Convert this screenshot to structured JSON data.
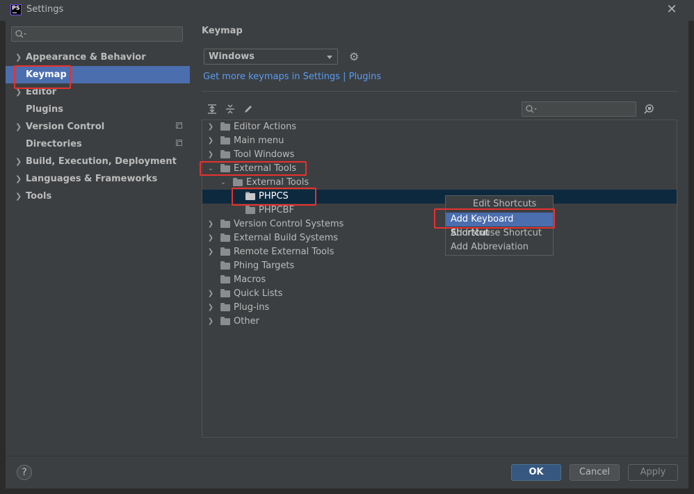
{
  "window": {
    "title": "Settings",
    "app_logo": "PS"
  },
  "sidebar": {
    "search_placeholder": "",
    "items": [
      {
        "label": "Appearance & Behavior",
        "has_chevron": true
      },
      {
        "label": "Keymap",
        "selected": true
      },
      {
        "label": "Editor",
        "has_chevron": true
      },
      {
        "label": "Plugins"
      },
      {
        "label": "Version Control",
        "has_chevron": true,
        "project_icon": true
      },
      {
        "label": "Directories",
        "project_icon": true
      },
      {
        "label": "Build, Execution, Deployment",
        "has_chevron": true
      },
      {
        "label": "Languages & Frameworks",
        "has_chevron": true
      },
      {
        "label": "Tools",
        "has_chevron": true
      }
    ]
  },
  "main": {
    "title": "Keymap",
    "keymap_select": {
      "value": "Windows"
    },
    "plugins_link": "Get more keymaps in Settings | Plugins",
    "toolbar": {
      "expand_all": "expand-all-icon",
      "collapse_all": "collapse-all-icon",
      "edit": "pencil-icon",
      "find_by_shortcut": "find-shortcut-icon"
    },
    "tree_search_placeholder": ""
  },
  "tree": [
    {
      "label": "Editor Actions",
      "expanded": false
    },
    {
      "label": "Main menu",
      "expanded": false
    },
    {
      "label": "Tool Windows",
      "expanded": false
    },
    {
      "label": "External Tools",
      "expanded": true
    },
    {
      "label": "External Tools",
      "expanded": true
    },
    {
      "label": "PHPCS",
      "selected": true
    },
    {
      "label": "PHPCBF"
    },
    {
      "label": "Version Control Systems",
      "expanded": false
    },
    {
      "label": "External Build Systems",
      "expanded": false
    },
    {
      "label": "Remote External Tools",
      "expanded": false
    },
    {
      "label": "Phing Targets"
    },
    {
      "label": "Macros"
    },
    {
      "label": "Quick Lists",
      "expanded": false
    },
    {
      "label": "Plug-ins",
      "expanded": false
    },
    {
      "label": "Other",
      "expanded": false
    }
  ],
  "context_menu": {
    "header": "Edit Shortcuts",
    "items": [
      {
        "label": "Add Keyboard Shortcut",
        "highlighted": true
      },
      {
        "label": "Add Mouse Shortcut"
      },
      {
        "label": "Add Abbreviation"
      }
    ]
  },
  "footer": {
    "help": "?",
    "ok": "OK",
    "cancel": "Cancel",
    "apply": "Apply"
  },
  "colors": {
    "accent": "#4b6eaf",
    "link": "#589df6",
    "highlight_box": "#e8312f",
    "selection_row": "#0d293e"
  }
}
